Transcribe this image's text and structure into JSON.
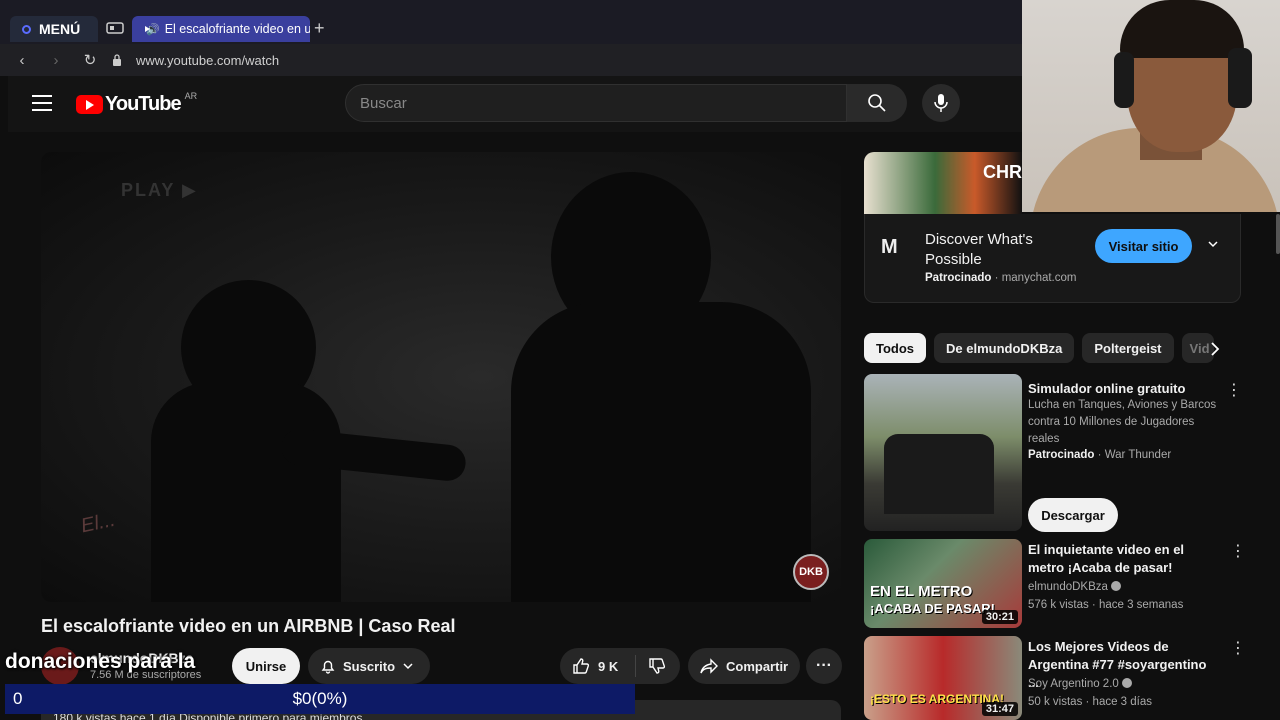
{
  "browser": {
    "menu_label": "MENÚ",
    "tab_title": "El escalofriante video en un AIRBNB | Caso Real",
    "url": "www.youtube.com/watch"
  },
  "header": {
    "logo_text": "YouTube",
    "country_code": "AR",
    "search_placeholder": "Buscar"
  },
  "video": {
    "title": "El escalofriante video en un AIRBNB | Caso Real",
    "watermark_left": "El...",
    "watermark_right": "DKB",
    "ghost_text": "PLAY ▶",
    "channel": "elmundoDKBza",
    "subscribers": "7.56 M de suscriptores",
    "join_label": "Unirse",
    "subscribe_label": "Suscrito",
    "likes": "9 K",
    "share_label": "Compartir",
    "more_label": "···",
    "description_preview": "180 k vistas  hace 1 día  Disponible primero para miembros"
  },
  "overlay": {
    "donation_text": "donaciones para la",
    "donation_amount": "0",
    "donation_progress": "$0(0%)",
    "progress_fraction": 0.0
  },
  "ad": {
    "banner_text": "CHR",
    "logo": "M",
    "title": "Discover What's Possible",
    "sponsored_label": "Patrocinado",
    "domain": "manychat.com",
    "cta": "Visitar sitio"
  },
  "chips": [
    "Todos",
    "De elmundoDKBza",
    "Poltergeist",
    "Vid"
  ],
  "recommendations": [
    {
      "title": "Simulador online gratuito",
      "description": "Lucha en Tanques, Aviones y Barcos contra 10 Millones de Jugadores reales",
      "sponsored_label": "Patrocinado",
      "advertiser": "War Thunder",
      "cta": "Descargar"
    },
    {
      "title": "El inquietante video en el metro ¡Acaba de pasar!",
      "channel": "elmundoDKBza",
      "stats": "576 k vistas · hace 3 semanas",
      "duration": "30:21",
      "thumb_text_1": "EN EL METRO",
      "thumb_text_2": "¡ACABA DE PASAR!"
    },
    {
      "title": "Los Mejores Videos de Argentina #77 #soyargentino ...",
      "channel": "Soy Argentino 2.0",
      "stats": "50 k vistas · hace 3 días",
      "duration": "31:47",
      "thumb_text_1": "¡ESTO ES ARGENTINA!"
    }
  ],
  "colors": {
    "background": "#0f0f0f",
    "accent_blue": "#3ea6ff",
    "youtube_red": "#ff0000",
    "donation_bar": "#0d1a66"
  }
}
